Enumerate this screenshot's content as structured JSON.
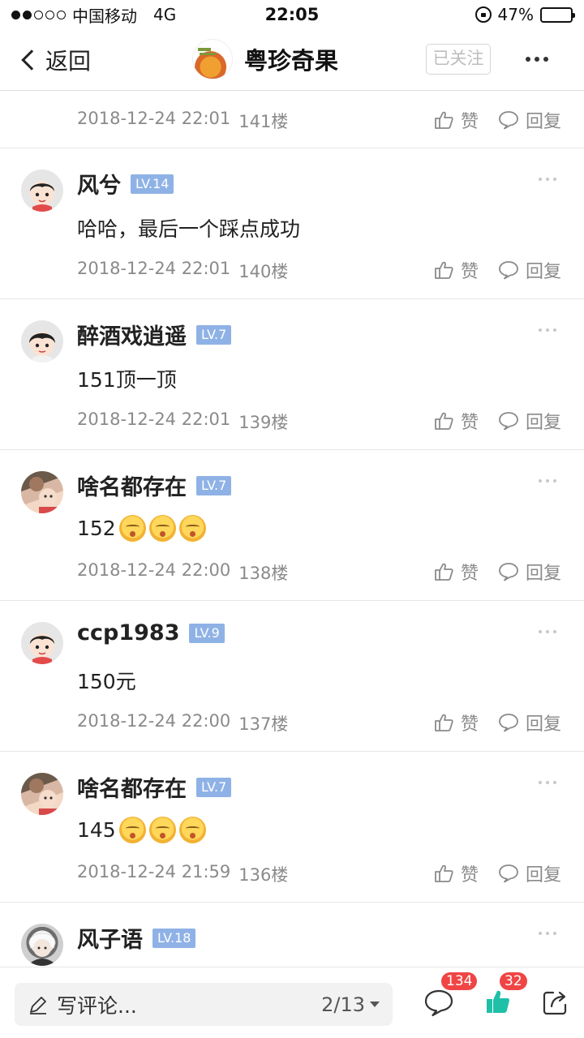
{
  "status_bar": {
    "carrier": "中国移动",
    "network": "4G",
    "time": "22:05",
    "battery": "47%",
    "battery_level": 0.47
  },
  "nav": {
    "back_label": "返回",
    "title": "粤珍奇果",
    "follow_label": "已关注"
  },
  "first_meta": {
    "timestamp": "2018-12-24 22:01",
    "floor": "141楼",
    "like_label": "赞",
    "reply_label": "回复"
  },
  "posts": [
    {
      "username": "风兮",
      "level": "LV.14",
      "content": "哈哈，最后一个踩点成功",
      "emoji_count": 0,
      "timestamp": "2018-12-24 22:01",
      "floor": "140楼",
      "like_label": "赞",
      "reply_label": "回复"
    },
    {
      "username": "醉酒戏逍遥",
      "level": "LV.7",
      "content": "151顶一顶",
      "emoji_count": 0,
      "timestamp": "2018-12-24 22:01",
      "floor": "139楼",
      "like_label": "赞",
      "reply_label": "回复"
    },
    {
      "username": "啥名都存在",
      "level": "LV.7",
      "content": "152",
      "emoji_count": 3,
      "timestamp": "2018-12-24 22:00",
      "floor": "138楼",
      "like_label": "赞",
      "reply_label": "回复"
    },
    {
      "username": "ccp1983",
      "level": "LV.9",
      "content": "150元",
      "emoji_count": 0,
      "timestamp": "2018-12-24 22:00",
      "floor": "137楼",
      "like_label": "赞",
      "reply_label": "回复"
    },
    {
      "username": "啥名都存在",
      "level": "LV.7",
      "content": "145",
      "emoji_count": 3,
      "timestamp": "2018-12-24 21:59",
      "floor": "136楼",
      "like_label": "赞",
      "reply_label": "回复"
    },
    {
      "username": "风子语",
      "level": "LV.18"
    }
  ],
  "bottom_bar": {
    "comment_placeholder": "写评论...",
    "page_indicator": "2/13",
    "comment_count": "134",
    "like_count": "32"
  },
  "colors": {
    "level_badge": "#8fb2e6",
    "like_icon": "#1fbfa8",
    "count_badge": "#f04545"
  }
}
